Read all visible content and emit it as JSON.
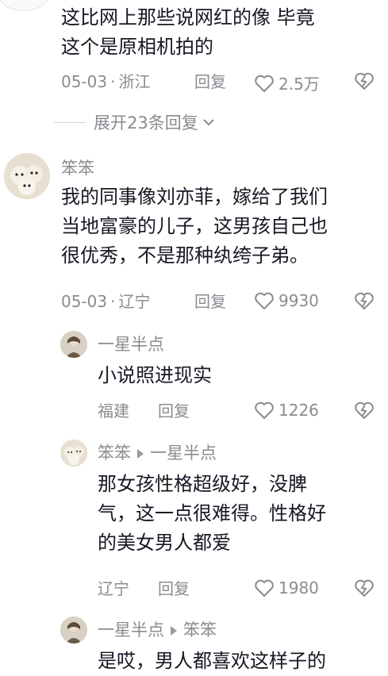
{
  "comment0": {
    "text_line1": "这比网上那些说网红的像 毕竟",
    "text_line2": "这个是原相机拍的",
    "date": "05-03",
    "location": "浙江",
    "reply_label": "回复",
    "likes": "2.5万"
  },
  "expand_replies": {
    "label": "展开23条回复"
  },
  "comment1": {
    "username": "笨笨",
    "text_line1": "我的同事像刘亦菲，嫁给了我们",
    "text_line2": "当地富豪的儿子，这男孩自己也",
    "text_line3": "很优秀，不是那种纨绔子弟。",
    "date": "05-03",
    "location": "辽宁",
    "reply_label": "回复",
    "likes": "9930"
  },
  "reply1": {
    "username": "一星半点",
    "text": "小说照进现实",
    "location": "福建",
    "reply_label": "回复",
    "likes": "1226"
  },
  "reply2": {
    "username": "笨笨",
    "reply_to": "一星半点",
    "text_line1": "那女孩性格超级好，没脾",
    "text_line2": "气，这一点很难得。性格好",
    "text_line3": "的美女男人都爱",
    "location": "辽宁",
    "reply_label": "回复",
    "likes": "1980"
  },
  "reply3": {
    "username": "一星半点",
    "reply_to": "笨笨",
    "text_line1": "是哎，男人都喜欢这样子的"
  },
  "colors": {
    "secondary_text": "#8a8b91",
    "primary_text": "#161823"
  },
  "icons": [
    "heart-outline-icon",
    "dislike-heart-icon",
    "chevron-down-icon",
    "triangle-right-icon"
  ]
}
